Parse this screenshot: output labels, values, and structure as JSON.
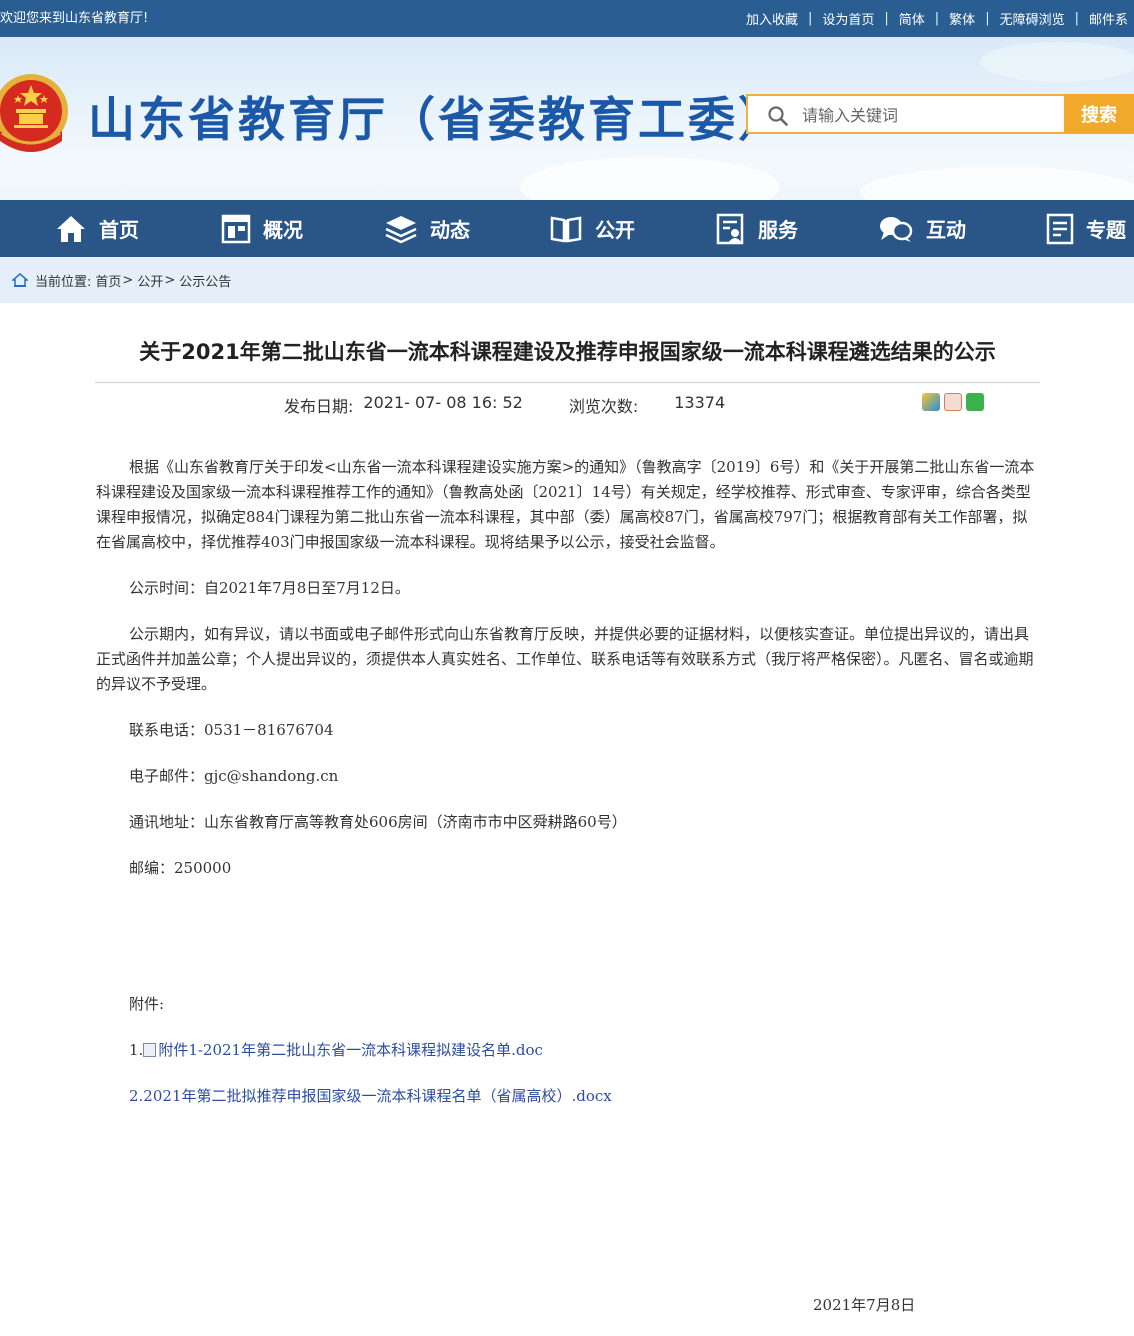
{
  "topbar": {
    "welcome": "欢迎您来到山东省教育厅!",
    "links": [
      "加入收藏",
      "设为首页",
      "简体",
      "繁体",
      "无障碍浏览",
      "邮件系"
    ]
  },
  "header": {
    "site_title": "山东省教育厅（省委教育工委）",
    "search_placeholder": "请输入关键词",
    "search_button": "搜索"
  },
  "nav": {
    "items": [
      {
        "label": "首页",
        "icon": "home-icon"
      },
      {
        "label": "概况",
        "icon": "window-icon"
      },
      {
        "label": "动态",
        "icon": "stack-icon"
      },
      {
        "label": "公开",
        "icon": "book-icon"
      },
      {
        "label": "服务",
        "icon": "service-icon"
      },
      {
        "label": "互动",
        "icon": "chat-icon"
      },
      {
        "label": "专题",
        "icon": "document-icon"
      }
    ]
  },
  "breadcrumb": {
    "prefix": "当前位置:",
    "items": [
      "首页",
      "公开",
      "公示公告"
    ],
    "sep": ">"
  },
  "article": {
    "title": "关于2021年第二批山东省一流本科课程建设及推荐申报国家级一流本科课程遴选结果的公示",
    "publish_label": "发布日期:",
    "publish_value": "2021- 07- 08 16: 52",
    "views_label": "浏览次数:",
    "views_value": "13374",
    "paragraphs": [
      "根据《山东省教育厅关于印发<山东省一流本科课程建设实施方案>的通知》（鲁教高字〔2019〕6号）和《关于开展第二批山东省一流本科课程建设及国家级一流本科课程推荐工作的通知》（鲁教高处函〔2021〕14号）有关规定，经学校推荐、形式审查、专家评审，综合各类型课程申报情况，拟确定884门课程为第二批山东省一流本科课程，其中部（委）属高校87门，省属高校797门；根据教育部有关工作部署，拟在省属高校中，择优推荐403门申报国家级一流本科课程。现将结果予以公示，接受社会监督。",
      "公示时间：自2021年7月8日至7月12日。",
      "公示期内，如有异议，请以书面或电子邮件形式向山东省教育厅反映，并提供必要的证据材料，以便核实查证。单位提出异议的，请出具正式函件并加盖公章；个人提出异议的，须提供本人真实姓名、工作单位、联系电话等有效联系方式（我厅将严格保密）。凡匿名、冒名或逾期的异议不予受理。",
      "联系电话：0531－81676704",
      "电子邮件：gjc@shandong.cn",
      "通讯地址：山东省教育厅高等教育处606房间（济南市市中区舜耕路60号）",
      "邮编：250000"
    ],
    "attachments_label": "附件:",
    "attachment_1_prefix": "1.",
    "attachment_1": "附件1-2021年第二批山东省一流本科课程拟建设名单.doc",
    "attachment_2": "2.2021年第二批拟推荐申报国家级一流本科课程名单（省属高校）.docx",
    "date": "2021年7月8日"
  }
}
